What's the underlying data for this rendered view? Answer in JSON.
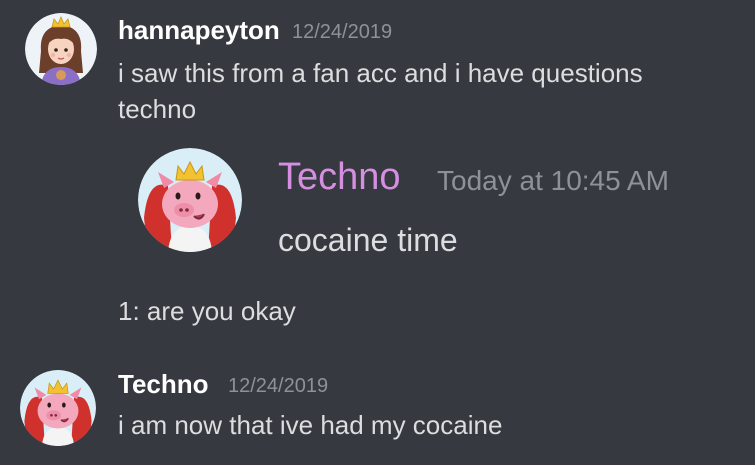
{
  "messages": [
    {
      "username": "hannapeyton",
      "timestamp": "12/24/2019",
      "avatar_icon": "girl-crown-avatar-icon",
      "lines": [
        "i saw this from a fan acc and i have questions",
        "techno",
        "1: are you okay"
      ],
      "embed": {
        "username": "Techno",
        "username_color": "#d58ee0",
        "timestamp": "Today at 10:45 AM",
        "text": "cocaine time",
        "avatar_icon": "pig-crown-avatar-icon"
      }
    },
    {
      "username": "Techno",
      "timestamp": "12/24/2019",
      "avatar_icon": "pig-crown-avatar-icon",
      "lines": [
        "i am now that ive had my cocaine"
      ]
    }
  ],
  "colors": {
    "background": "#36393f",
    "text": "#dcddde",
    "muted": "#8e9297"
  }
}
